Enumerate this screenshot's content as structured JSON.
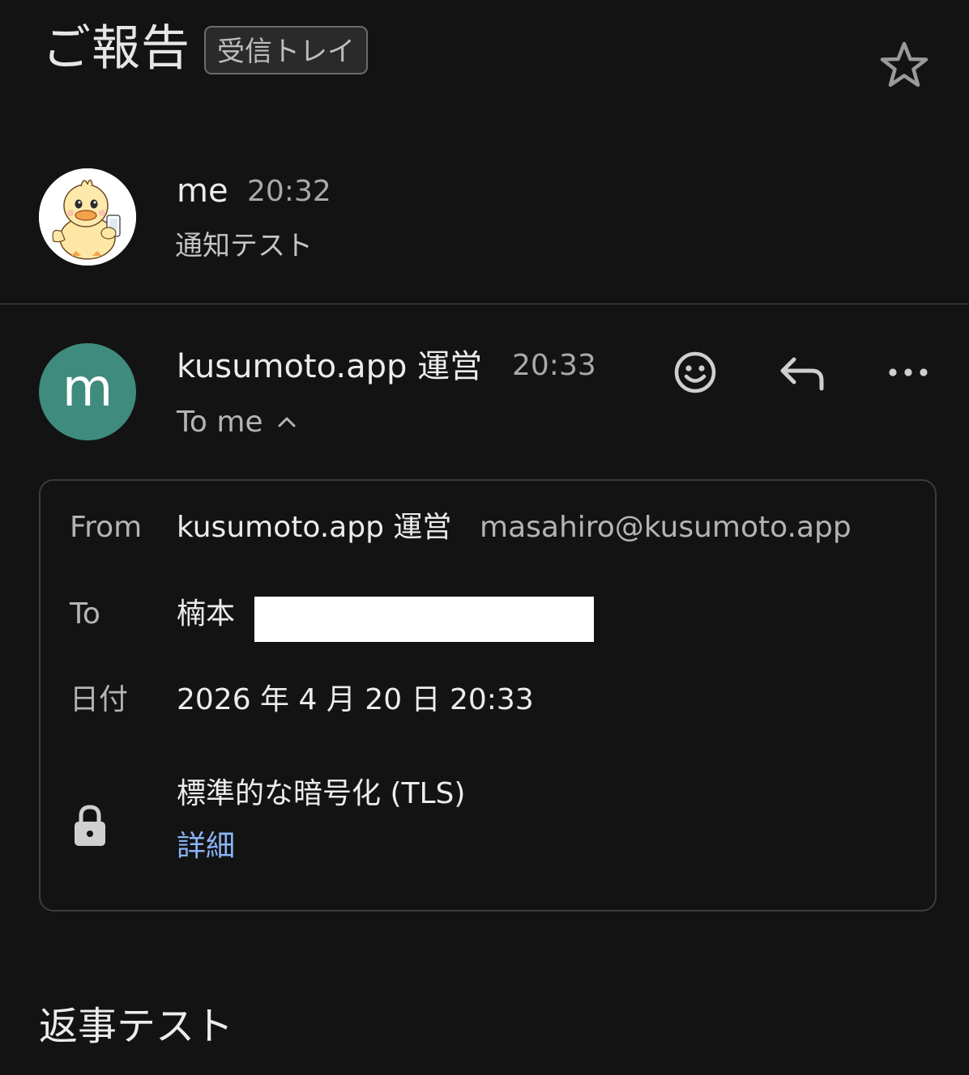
{
  "thread": {
    "subject": "ご報告",
    "label": "受信トレイ"
  },
  "messages": [
    {
      "sender": "me",
      "time": "20:32",
      "snippet": "通知テスト",
      "avatar": "duck-avatar"
    },
    {
      "sender": "kusumoto.app 運営",
      "avatar_letter": "m",
      "avatar_color": "#3f8b7e",
      "time": "20:33",
      "recipient_summary": "To me",
      "details": {
        "from_label": "From",
        "from_name": "kusumoto.app 運営",
        "from_email": "masahiro@kusumoto.app",
        "to_label": "To",
        "to_name": "楠本",
        "date_label": "日付",
        "date_value": "2026 年 4 月 20 日 20:33",
        "encryption": "標準的な暗号化 (TLS)",
        "details_link": "詳細"
      },
      "body": "返事テスト"
    }
  ],
  "icons": {
    "star": "star-outline-icon",
    "emoji": "emoji-icon",
    "reply": "reply-icon",
    "more": "more-horizontal-icon",
    "chevron": "chevron-up-icon",
    "lock": "lock-icon"
  },
  "colors": {
    "background": "#131313",
    "link": "#8ab4f8"
  }
}
